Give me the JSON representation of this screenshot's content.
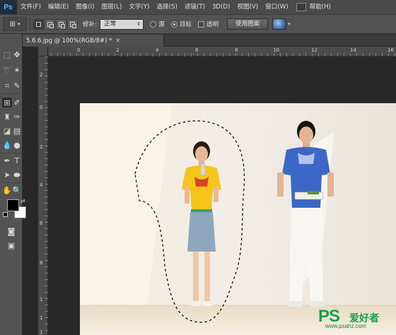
{
  "app": {
    "logo": "Ps"
  },
  "menu": [
    "文件(F)",
    "编辑(E)",
    "图像(I)",
    "图层(L)",
    "文字(Y)",
    "选择(S)",
    "滤镜(T)",
    "3D(D)",
    "视图(V)",
    "窗口(W)",
    "帮助(H)"
  ],
  "options": {
    "patch_label": "修补:",
    "patch_mode": "正常",
    "source_label": "源",
    "target_label": "目标",
    "transparent_label": "透明",
    "use_pattern_label": "使用图案",
    "selected_option": "目标"
  },
  "document": {
    "tab_title": "5.6.6.jpg @ 100%(RGB/8#) *",
    "close_glyph": "×"
  },
  "rulers": {
    "horizontal": [
      "0",
      "2",
      "4",
      "6",
      "8",
      "10",
      "12",
      "14",
      "16"
    ],
    "vertical": [
      "2",
      "0",
      "2",
      "4",
      "6",
      "8",
      "1",
      "1",
      "1"
    ]
  },
  "tools": [
    "rectangular-marquee",
    "move",
    "lasso",
    "magic-wand",
    "crop",
    "eyedropper",
    "patch",
    "brush",
    "clone-stamp",
    "history-brush",
    "eraser",
    "gradient",
    "blur",
    "dodge",
    "pen",
    "type",
    "path-selection",
    "ellipse",
    "hand",
    "zoom",
    "quick-mask",
    "screen-mode"
  ],
  "colors": {
    "foreground": "#000000",
    "background": "#ffffff",
    "ui_panel": "#535353",
    "menu_bar": "#4a4a4a",
    "workspace": "#282828",
    "watermark": "#1aa14a"
  },
  "watermark": {
    "brand": "PS",
    "cn_text": "爱好者",
    "url": "www.psahz.com"
  }
}
